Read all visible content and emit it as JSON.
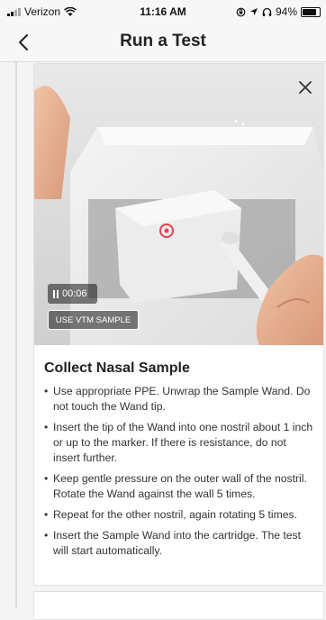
{
  "status_bar": {
    "carrier": "Verizon",
    "time": "11:16 AM",
    "battery": "94%",
    "battery_level": 0.94,
    "icons": [
      "signal-icon",
      "wifi-icon",
      "lock-rotation-icon",
      "location-icon",
      "headphones-icon",
      "battery-icon"
    ]
  },
  "nav": {
    "title": "Run a Test",
    "back_icon": "chevron-left-icon"
  },
  "video": {
    "timer": "00:06",
    "vtm_button": "USE VTM SAMPLE",
    "close_icon": "close-icon",
    "pause_icon": "pause-icon"
  },
  "section": {
    "title": "Collect Nasal Sample",
    "steps": [
      "Use appropriate PPE. Unwrap the Sample Wand. Do not touch the Wand tip.",
      "Insert the tip of the Wand into one nostril about 1 inch or up to the marker. If there is resistance, do not insert further.",
      "Keep gentle pressure on the outer wall of the nostril. Rotate the Wand against the wall 5 times.",
      "Repeat for the other nostril, again rotating 5 times.",
      "Insert the Sample Wand into the cartridge. The test will start automatically."
    ]
  }
}
